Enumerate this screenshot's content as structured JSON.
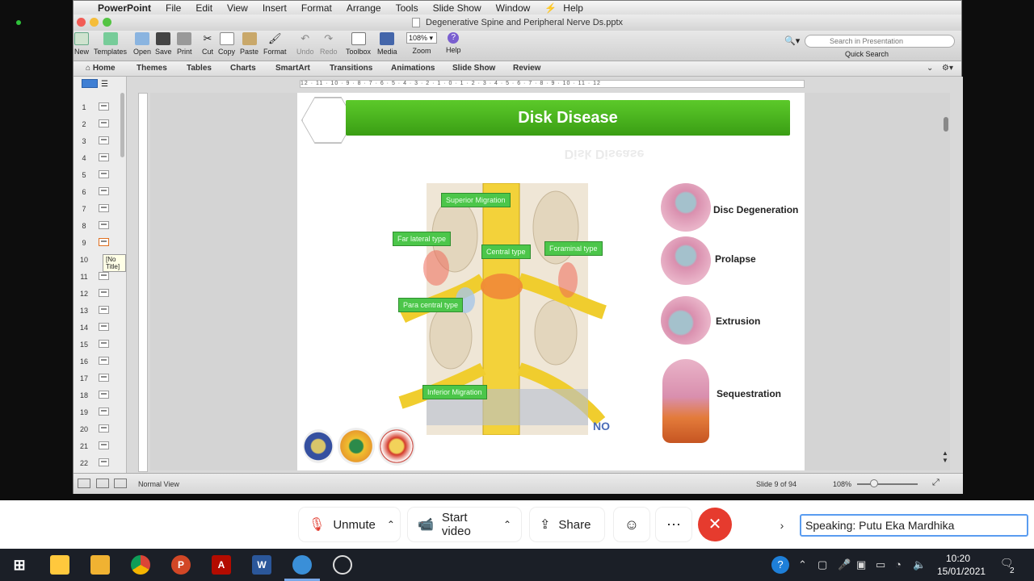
{
  "menubar": {
    "app": "PowerPoint",
    "items": [
      "File",
      "Edit",
      "View",
      "Insert",
      "Format",
      "Arrange",
      "Tools",
      "Slide Show",
      "Window"
    ],
    "help_icon": "lightning-icon",
    "help": "Help"
  },
  "window": {
    "title": "Degenerative Spine and Peripheral Nerve Ds.pptx"
  },
  "toolbar": {
    "new": "New",
    "templates": "Templates",
    "open": "Open",
    "save": "Save",
    "print": "Print",
    "cut": "Cut",
    "copy": "Copy",
    "paste": "Paste",
    "format": "Format",
    "undo": "Undo",
    "redo": "Redo",
    "toolbox": "Toolbox",
    "media": "Media",
    "zoom_value": "108%",
    "zoom": "Zoom",
    "help": "Help",
    "search_placeholder": "Search in Presentation",
    "quick_search": "Quick Search"
  },
  "ribbon_tabs": [
    "Home",
    "Themes",
    "Tables",
    "Charts",
    "SmartArt",
    "Transitions",
    "Animations",
    "Slide Show",
    "Review"
  ],
  "ruler": {
    "marks": "12 · 11 · 10 · 9 · 8 · 7 · 6 · 5 · 4 · 3 · 2 · 1 · 0 · 1 · 2 · 3 · 4 · 5 · 6 · 7 · 8 · 9 · 10 · 11 · 12"
  },
  "thumbnails": [
    "1",
    "2",
    "3",
    "4",
    "5",
    "6",
    "7",
    "8",
    "9",
    "10",
    "11",
    "12",
    "13",
    "14",
    "15",
    "16",
    "17",
    "18",
    "19",
    "20",
    "21",
    "22"
  ],
  "tooltip": "[No Title]",
  "slide": {
    "title": "Disk Disease",
    "title_reflection": "Disk Disease",
    "spine_labels": {
      "superior": "Superior Migration",
      "far_lateral": "Far lateral type",
      "central": "Central type",
      "foraminal": "Foraminal type",
      "para_central": "Para central type",
      "inferior": "Inferior Migration"
    },
    "watermark": "NO",
    "disc_types": [
      "Disc Degeneration",
      "Prolapse",
      "Extrusion",
      "Sequestration"
    ]
  },
  "status": {
    "view": "Normal View",
    "slide_pos": "Slide 9 of 94",
    "zoom": "108%"
  },
  "meeting": {
    "unmute": "Unmute",
    "start_video": "Start video",
    "share": "Share",
    "speaking_label": "Speaking:",
    "speaker": "Putu Eka Mardhika"
  },
  "taskbar": {
    "time": "10:20",
    "date": "15/01/2021",
    "notifications": "2"
  },
  "colors": {
    "slide_green": "#4cb82a",
    "end_red": "#e63b2e",
    "speaking_border": "#5a9cf0"
  }
}
